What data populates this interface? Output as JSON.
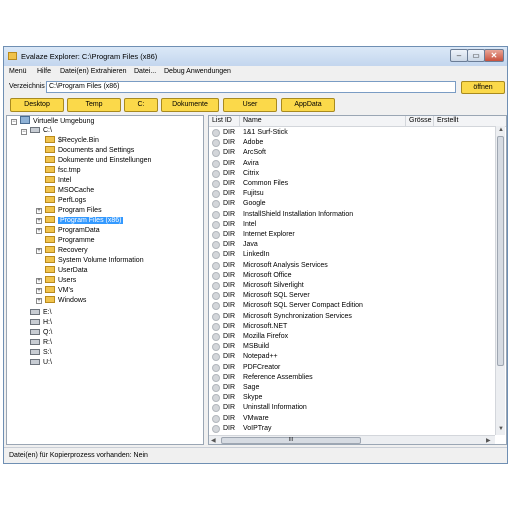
{
  "window": {
    "title": "Evalaze Explorer: C:\\Program Files (x86)",
    "minimize": "–",
    "maximize": "▭",
    "close": "✕"
  },
  "menu": [
    "Menü",
    "Hilfe",
    "Datei(en) Extrahieren",
    "Datei...",
    "Debug Anwendungen"
  ],
  "toolbar": {
    "directory_label": "Verzeichnis",
    "directory_value": "C:\\Program Files (x86)",
    "open_button": "öffnen"
  },
  "quick_buttons": [
    "Desktop",
    "Temp",
    "C:",
    "Dokumente",
    "User",
    "AppData"
  ],
  "tree": {
    "root": "Virtuelle Umgebung",
    "drive_c": "C:\\",
    "c_children": [
      "$Recycle.Bin",
      "Documents and Settings",
      "Dokumente und Einstellungen",
      "fsc.tmp",
      "Intel",
      "MSOCache",
      "PerfLogs",
      "Program Files",
      "Program Files (x86)",
      "ProgramData",
      "Programme",
      "Recovery",
      "System Volume Information",
      "UserData",
      "Users",
      "VM's",
      "Windows"
    ],
    "other_drives": [
      "E:\\",
      "H:\\",
      "Q:\\",
      "R:\\",
      "S:\\",
      "U:\\"
    ]
  },
  "list": {
    "columns": [
      "List ID",
      "Name",
      "Grösse",
      "Erstellt"
    ],
    "rows": [
      {
        "type": "DIR",
        "name": "1&1 Surf-Stick"
      },
      {
        "type": "DIR",
        "name": "Adobe"
      },
      {
        "type": "DIR",
        "name": "ArcSoft"
      },
      {
        "type": "DIR",
        "name": "Avira"
      },
      {
        "type": "DIR",
        "name": "Citrix"
      },
      {
        "type": "DIR",
        "name": "Common Files"
      },
      {
        "type": "DIR",
        "name": "Fujitsu"
      },
      {
        "type": "DIR",
        "name": "Google"
      },
      {
        "type": "DIR",
        "name": "InstallShield Installation Information"
      },
      {
        "type": "DIR",
        "name": "Intel"
      },
      {
        "type": "DIR",
        "name": "Internet Explorer"
      },
      {
        "type": "DIR",
        "name": "Java"
      },
      {
        "type": "DIR",
        "name": "LinkedIn"
      },
      {
        "type": "DIR",
        "name": "Microsoft Analysis Services"
      },
      {
        "type": "DIR",
        "name": "Microsoft Office"
      },
      {
        "type": "DIR",
        "name": "Microsoft Silverlight"
      },
      {
        "type": "DIR",
        "name": "Microsoft SQL Server"
      },
      {
        "type": "DIR",
        "name": "Microsoft SQL Server Compact Edition"
      },
      {
        "type": "DIR",
        "name": "Microsoft Synchronization Services"
      },
      {
        "type": "DIR",
        "name": "Microsoft.NET"
      },
      {
        "type": "DIR",
        "name": "Mozilla Firefox"
      },
      {
        "type": "DIR",
        "name": "MSBuild"
      },
      {
        "type": "DIR",
        "name": "Notepad++"
      },
      {
        "type": "DIR",
        "name": "PDFCreator"
      },
      {
        "type": "DIR",
        "name": "Reference Assemblies"
      },
      {
        "type": "DIR",
        "name": "Sage"
      },
      {
        "type": "DIR",
        "name": "Skype"
      },
      {
        "type": "DIR",
        "name": "Uninstall Information"
      },
      {
        "type": "DIR",
        "name": "VMware"
      },
      {
        "type": "DIR",
        "name": "VoIPTray"
      }
    ],
    "hscroll_grip": "III"
  },
  "status": "Datei(en) für Kopierprozess vorhanden: Nein",
  "colors": {
    "button_yellow": "#fbd94a",
    "selection_blue": "#3399ff",
    "window_bg": "#f0f0f0"
  }
}
